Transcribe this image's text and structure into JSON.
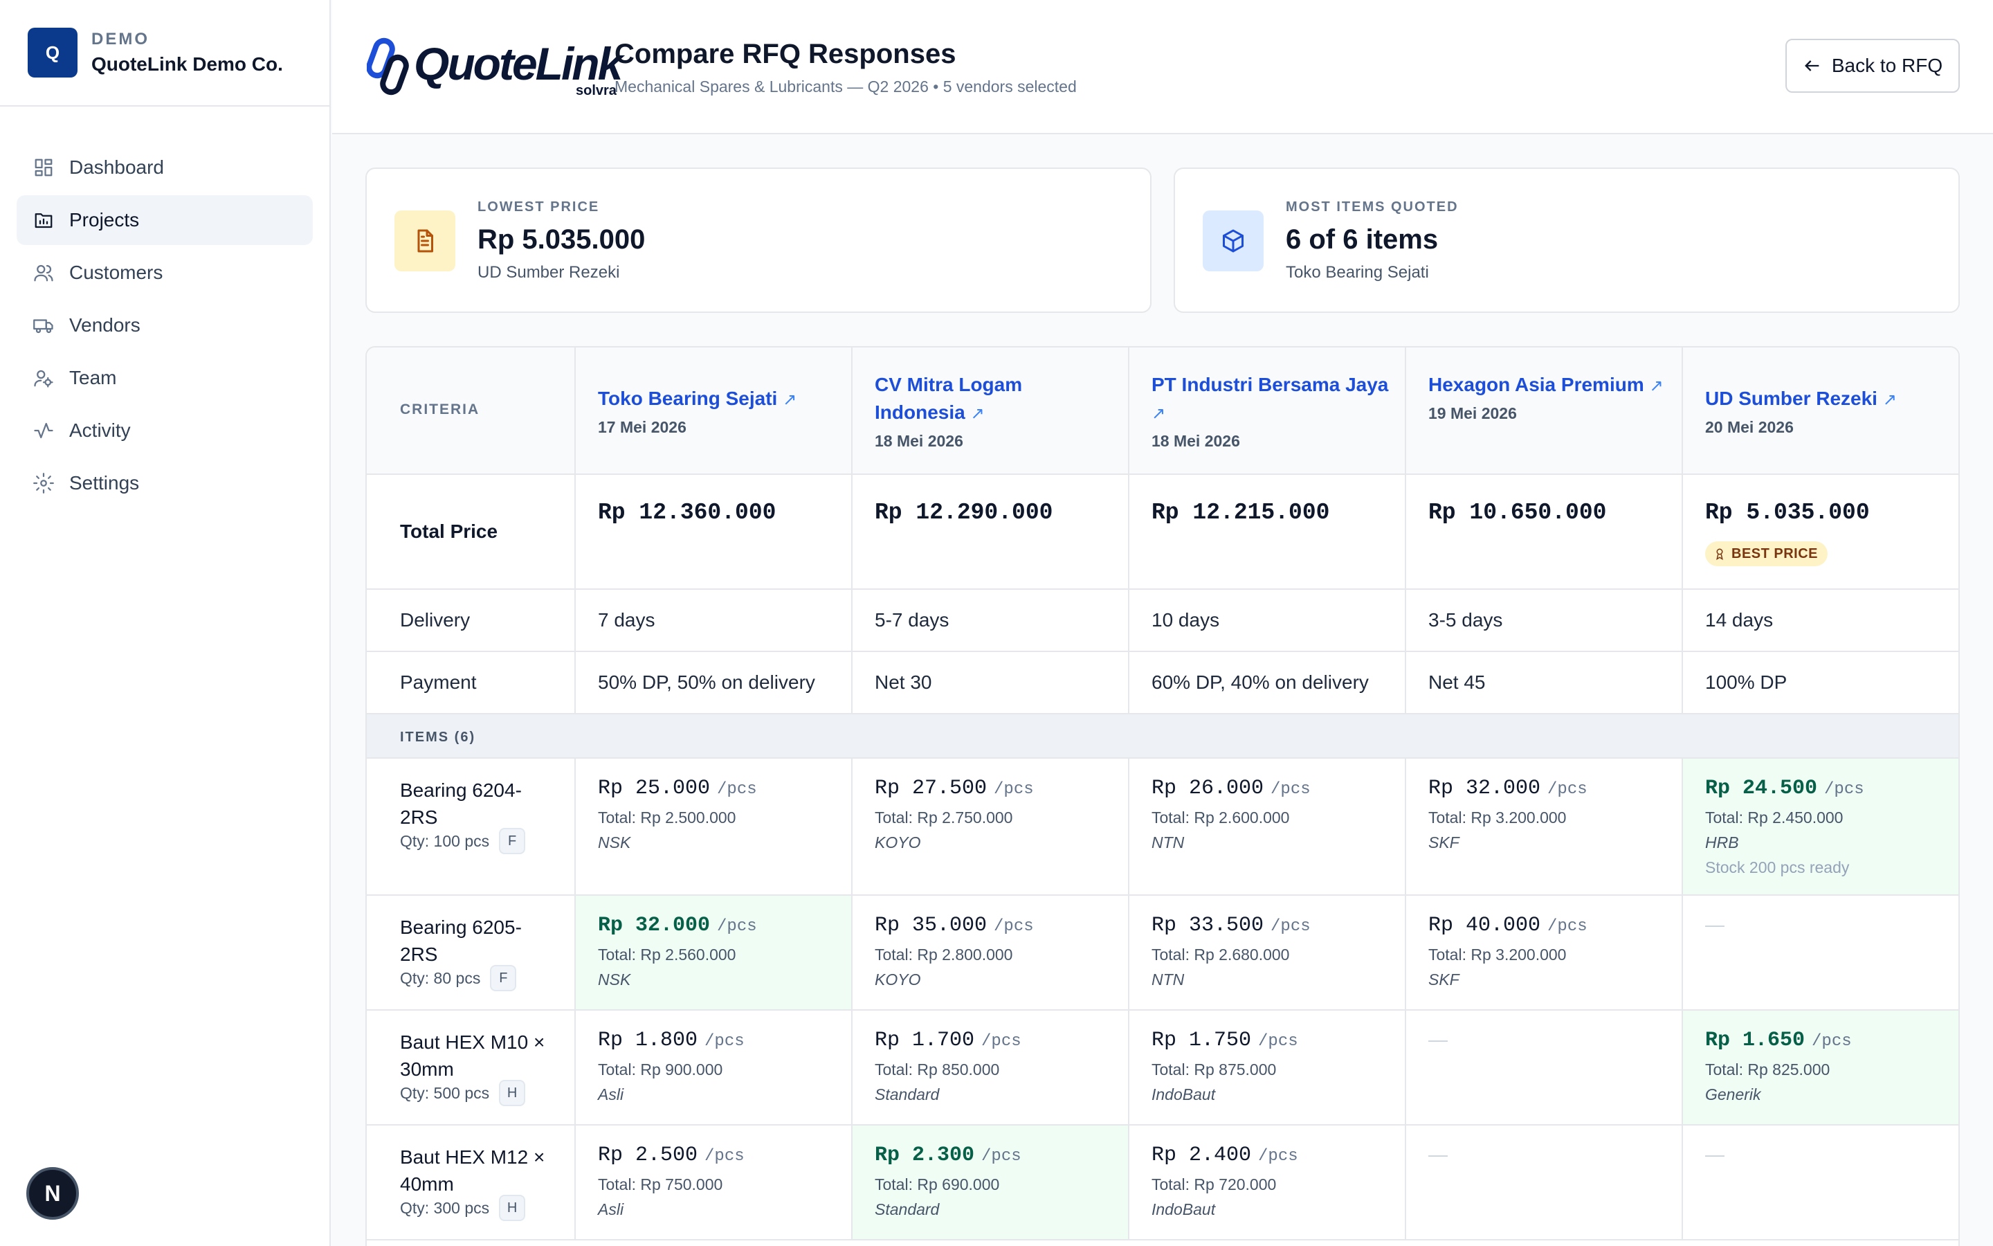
{
  "brand": {
    "logo_letter": "Q",
    "tag": "DEMO",
    "company": "QuoteLink Demo Co."
  },
  "nav": [
    {
      "label": "Dashboard",
      "icon": "dashboard-icon"
    },
    {
      "label": "Projects",
      "icon": "projects-icon",
      "active": true
    },
    {
      "label": "Customers",
      "icon": "customers-icon"
    },
    {
      "label": "Vendors",
      "icon": "vendors-icon"
    },
    {
      "label": "Team",
      "icon": "team-icon"
    },
    {
      "label": "Activity",
      "icon": "activity-icon"
    },
    {
      "label": "Settings",
      "icon": "settings-icon"
    }
  ],
  "dev_badge": "N",
  "header": {
    "logo_word": "QuoteLink",
    "logo_sub": "solvra",
    "title": "Compare RFQ Responses",
    "subtitle": "Mechanical Spares & Lubricants — Q2 2026 • 5 vendors selected",
    "back_label": "Back to RFQ"
  },
  "summary": {
    "lowest": {
      "label": "LOWEST PRICE",
      "value": "Rp 5.035.000",
      "sub": "UD Sumber Rezeki"
    },
    "most": {
      "label": "MOST ITEMS QUOTED",
      "value": "6 of 6 items",
      "sub": "Toko Bearing Sejati"
    }
  },
  "table": {
    "criteria_label": "CRITERIA",
    "total_label": "Total Price",
    "delivery_label": "Delivery",
    "payment_label": "Payment",
    "items_label": "ITEMS (6)",
    "best_price_label": "BEST PRICE",
    "unit": "/pcs",
    "dash": "—",
    "vendors": [
      {
        "name": "Toko Bearing Sejati",
        "date": "17 Mei 2026",
        "total": "Rp 12.360.000",
        "delivery": "7 days",
        "payment": "50% DP, 50% on delivery"
      },
      {
        "name": "CV Mitra Logam Indonesia",
        "date": "18 Mei 2026",
        "total": "Rp 12.290.000",
        "delivery": "5-7 days",
        "payment": "Net 30"
      },
      {
        "name": "PT Industri Bersama Jaya",
        "date": "18 Mei 2026",
        "total": "Rp 12.215.000",
        "delivery": "10 days",
        "payment": "60% DP, 40% on delivery"
      },
      {
        "name": "Hexagon Asia Premium",
        "date": "19 Mei 2026",
        "total": "Rp 10.650.000",
        "delivery": "3-5 days",
        "payment": "Net 45"
      },
      {
        "name": "UD Sumber Rezeki",
        "date": "20 Mei 2026",
        "total": "Rp 5.035.000",
        "delivery": "14 days",
        "payment": "100% DP",
        "best": true
      }
    ],
    "items": [
      {
        "name": "Bearing 6204-2RS",
        "qty": "Qty: 100 pcs",
        "tag": "F",
        "quotes": [
          {
            "price": "Rp 25.000",
            "total": "Total: Rp 2.500.000",
            "brand": "NSK"
          },
          {
            "price": "Rp 27.500",
            "total": "Total: Rp 2.750.000",
            "brand": "KOYO"
          },
          {
            "price": "Rp 26.000",
            "total": "Total: Rp 2.600.000",
            "brand": "NTN"
          },
          {
            "price": "Rp 32.000",
            "total": "Total: Rp 3.200.000",
            "brand": "SKF"
          },
          {
            "price": "Rp 24.500",
            "total": "Total: Rp 2.450.000",
            "brand": "HRB",
            "note": "Stock 200 pcs ready",
            "best": true
          }
        ]
      },
      {
        "name": "Bearing 6205-2RS",
        "qty": "Qty: 80 pcs",
        "tag": "F",
        "quotes": [
          {
            "price": "Rp 32.000",
            "total": "Total: Rp 2.560.000",
            "brand": "NSK",
            "best": true
          },
          {
            "price": "Rp 35.000",
            "total": "Total: Rp 2.800.000",
            "brand": "KOYO"
          },
          {
            "price": "Rp 33.500",
            "total": "Total: Rp 2.680.000",
            "brand": "NTN"
          },
          {
            "price": "Rp 40.000",
            "total": "Total: Rp 3.200.000",
            "brand": "SKF"
          },
          null
        ]
      },
      {
        "name": "Baut HEX M10 × 30mm",
        "qty": "Qty: 500 pcs",
        "tag": "H",
        "quotes": [
          {
            "price": "Rp 1.800",
            "total": "Total: Rp 900.000",
            "brand": "Asli"
          },
          {
            "price": "Rp 1.700",
            "total": "Total: Rp 850.000",
            "brand": "Standard"
          },
          {
            "price": "Rp 1.750",
            "total": "Total: Rp 875.000",
            "brand": "IndoBaut"
          },
          null,
          {
            "price": "Rp 1.650",
            "total": "Total: Rp 825.000",
            "brand": "Generik",
            "best": true
          }
        ]
      },
      {
        "name": "Baut HEX M12 × 40mm",
        "qty": "Qty: 300 pcs",
        "tag": "H",
        "quotes": [
          {
            "price": "Rp 2.500",
            "total": "Total: Rp 750.000",
            "brand": "Asli"
          },
          {
            "price": "Rp 2.300",
            "total": "Total: Rp 690.000",
            "brand": "Standard",
            "best": true
          },
          {
            "price": "Rp 2.400",
            "total": "Total: Rp 720.000",
            "brand": "IndoBaut"
          },
          null,
          null
        ]
      }
    ]
  },
  "colors": {
    "brand_blue": "#0b3a8c",
    "link_blue": "#1d4ed8",
    "best_green_bg": "#f0fdf4",
    "best_green_text": "#065f46",
    "badge_amber": "#fef3c7"
  }
}
